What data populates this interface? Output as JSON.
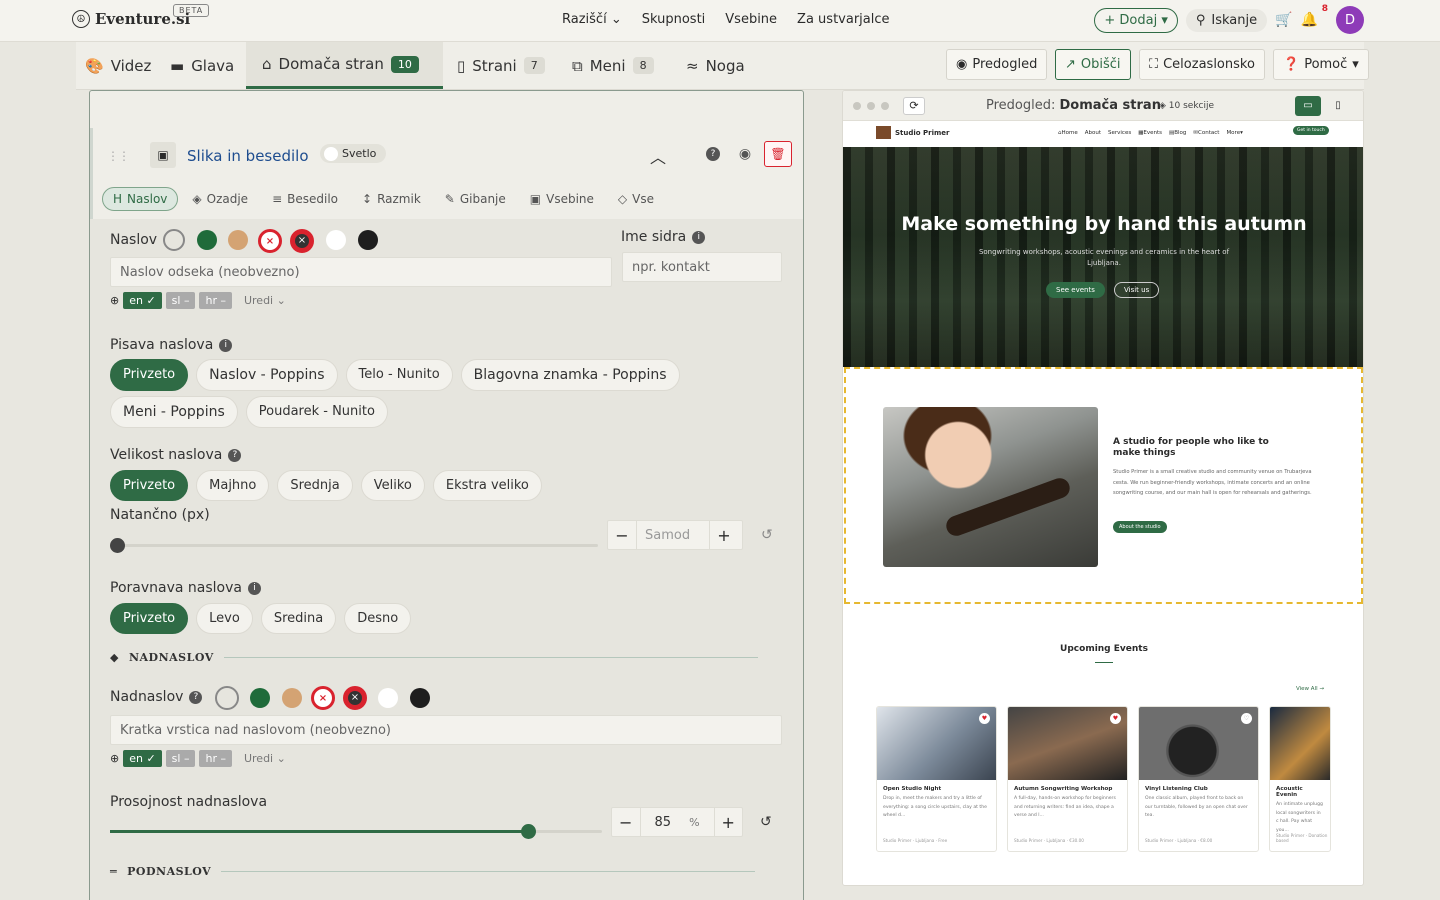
{
  "app": {
    "logo": "Eventure.si",
    "beta": "BETA"
  },
  "topnav": [
    "Raziščí",
    "Skupnosti",
    "Vsebine",
    "Za ustvarjalce"
  ],
  "topright": {
    "add": "+ Dodaj",
    "search": "Iskanje",
    "notif_count": "8",
    "avatar": "D"
  },
  "tabs": [
    {
      "label": "Videz"
    },
    {
      "label": "Glava"
    },
    {
      "label": "Domača stran",
      "count": "10"
    },
    {
      "label": "Strani",
      "count": "7"
    },
    {
      "label": "Meni",
      "count": "8"
    },
    {
      "label": "Noga"
    }
  ],
  "toolbar": {
    "preview": "Predogled",
    "visit": "Obišči",
    "fullscreen": "Celozaslonsko",
    "help": "Pomoč"
  },
  "section": {
    "title": "Slika in besedilo",
    "theme": "Svetlo"
  },
  "subtabs": [
    "Naslov",
    "Ozadje",
    "Besedilo",
    "Razmik",
    "Gibanje",
    "Vsebine",
    "Vse"
  ],
  "heading": {
    "label": "Naslov",
    "placeholder": "Naslov odseka (neobvezno)",
    "anchor_label": "Ime sidra",
    "anchor_placeholder": "npr. kontakt",
    "langs": [
      "en ✓",
      "sl –",
      "hr –"
    ],
    "edit": "Uredi"
  },
  "font": {
    "label": "Pisava naslova",
    "options_row1": [
      "Privzeto",
      "Naslov - Poppins",
      "Telo - Nunito",
      "Blagovna znamka - Poppins"
    ],
    "options_row2": [
      "Meni - Poppins",
      "Poudarek - Nunito"
    ]
  },
  "size": {
    "label": "Velikost naslova",
    "options": [
      "Privzeto",
      "Majhno",
      "Srednja",
      "Veliko",
      "Ekstra veliko"
    ],
    "exact_label": "Natančno (px)",
    "exact_placeholder": "Samod"
  },
  "align": {
    "label": "Poravnava naslova",
    "options": [
      "Privzeto",
      "Levo",
      "Sredina",
      "Desno"
    ]
  },
  "dividers": {
    "nadnaslov": "NADNASLOV",
    "podnaslov": "PODNASLOV"
  },
  "overline": {
    "label": "Nadnaslov",
    "placeholder": "Kratka vrstica nad naslovom (neobvezno)",
    "langs": [
      "en ✓",
      "sl –",
      "hr –"
    ],
    "edit": "Uredi"
  },
  "opacity": {
    "label": "Prosojnost nadnaslova",
    "value": "85",
    "unit": "%",
    "fraction": 0.85
  },
  "colors": {
    "accent": "#2f6b45",
    "danger": "#d9232e",
    "tan": "#d4a373",
    "dark": "#1e1e1e"
  },
  "preview": {
    "title_prefix": "Predogled:",
    "title": "Domača stran",
    "count": "10 sekcije",
    "site_name": "Studio Primer",
    "site_links": [
      "Home",
      "About",
      "Services",
      "Events",
      "Blog",
      "Contact",
      "More"
    ],
    "cta": "Get in touch",
    "hero_title": "Make something by hand this autumn",
    "hero_sub": "Songwriting workshops, acoustic evenings and ceramics in the heart of Ljubljana.",
    "hero_btn1": "See events",
    "hero_btn2": "Visit us",
    "studio_title": "A studio for people who like to make things",
    "studio_text": "Studio Primer is a small creative studio and community venue on Trubarjeva cesta. We run beginner-friendly workshops, intimate concerts and an online songwriting course, and our main hall is open for rehearsals and gatherings.",
    "studio_btn": "About the studio",
    "events_title": "Upcoming Events",
    "view_all": "View All →",
    "events": [
      {
        "title": "Open Studio Night",
        "desc": "Drop in, meet the makers and try a little of everything: a song circle upstairs, clay at the wheel d...",
        "meta": "Studio Primer · Ljubljana · Free"
      },
      {
        "title": "Autumn Songwriting Workshop",
        "desc": "A full-day, hands-on workshop for beginners and returning writers: find an idea, shape a verse and l...",
        "meta": "Studio Primer · Ljubljana · €30.00"
      },
      {
        "title": "Vinyl Listening Club",
        "desc": "One classic album, played front to back on our turntable, followed by an open chat over tea.",
        "meta": "Studio Primer · Ljubljana · €8.00"
      },
      {
        "title": "Acoustic Evenin",
        "desc": "An intimate unplugg local songwriters in c hall. Pay what you...",
        "meta": "Studio Primer · Donation based"
      }
    ]
  }
}
